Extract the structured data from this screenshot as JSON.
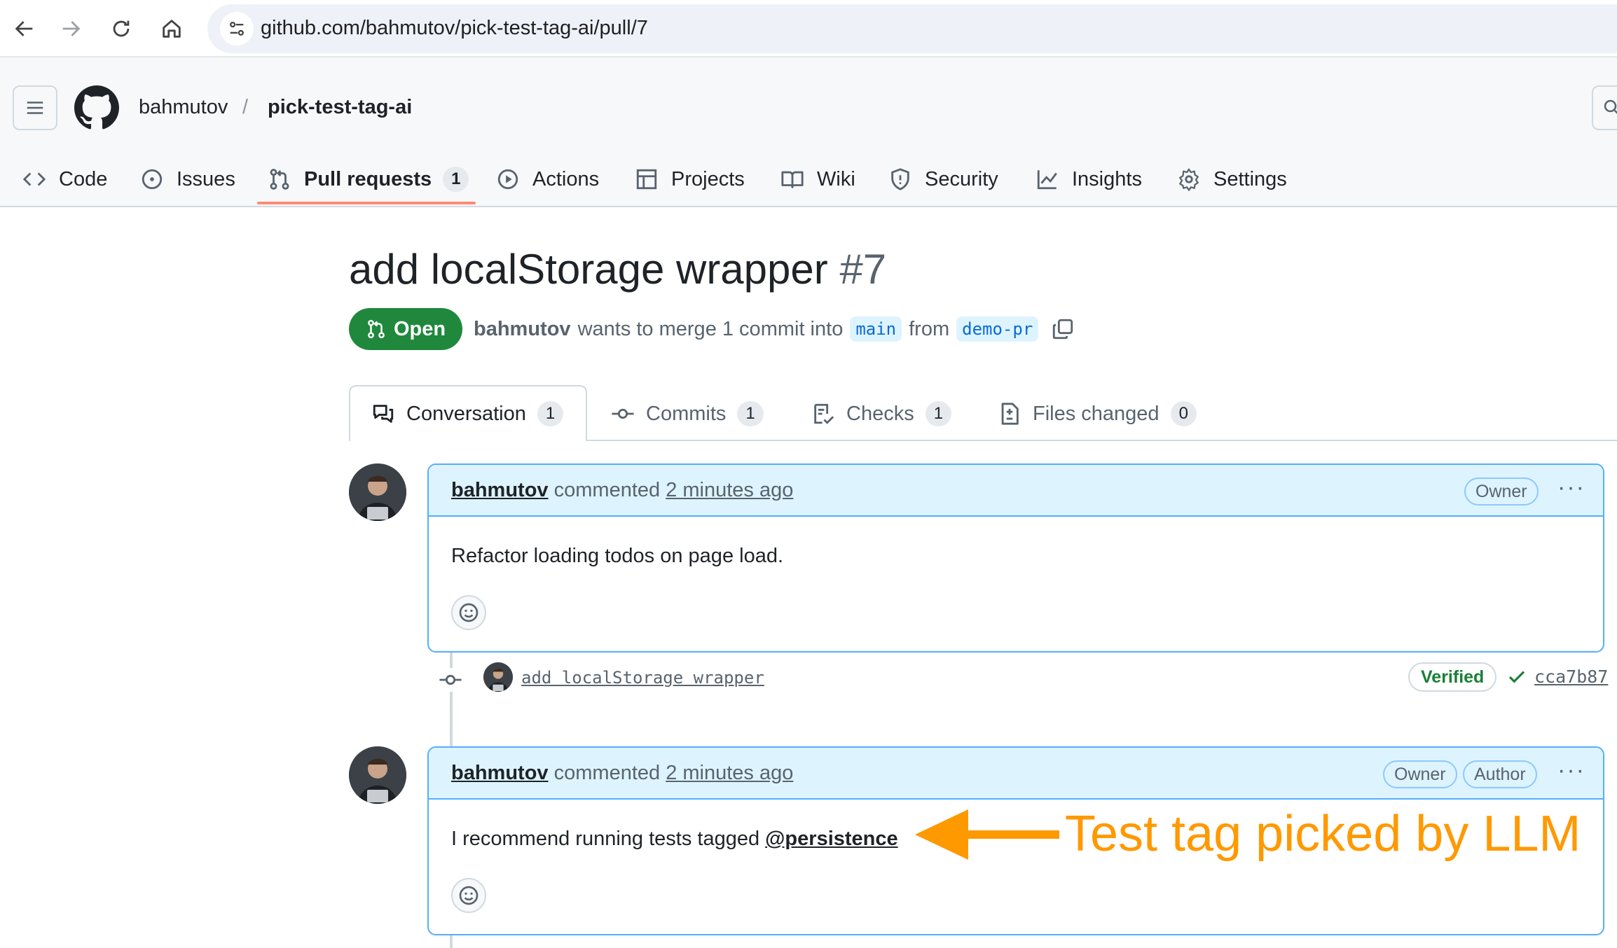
{
  "browser": {
    "url": "github.com/bahmutov/pick-test-tag-ai/pull/7"
  },
  "repo": {
    "owner": "bahmutov",
    "separator": "/",
    "name": "pick-test-tag-ai"
  },
  "repo_nav": {
    "tabs": [
      {
        "label": "Code",
        "icon": "code-icon"
      },
      {
        "label": "Issues",
        "icon": "issue-icon"
      },
      {
        "label": "Pull requests",
        "icon": "pull-request-icon",
        "counter": "1",
        "selected": true
      },
      {
        "label": "Actions",
        "icon": "play-icon"
      },
      {
        "label": "Projects",
        "icon": "table-icon"
      },
      {
        "label": "Wiki",
        "icon": "book-icon"
      },
      {
        "label": "Security",
        "icon": "shield-icon"
      },
      {
        "label": "Insights",
        "icon": "graph-icon"
      },
      {
        "label": "Settings",
        "icon": "gear-icon"
      }
    ]
  },
  "pr": {
    "title": "add localStorage wrapper",
    "number": "#7",
    "state": "Open",
    "author": "bahmutov",
    "merge_text": "wants to merge 1 commit into",
    "base_branch": "main",
    "from_text": "from",
    "head_branch": "demo-pr"
  },
  "pr_tabs": [
    {
      "label": "Conversation",
      "counter": "1",
      "icon": "comment-discussion-icon",
      "active": true
    },
    {
      "label": "Commits",
      "counter": "1",
      "icon": "commit-icon"
    },
    {
      "label": "Checks",
      "counter": "1",
      "icon": "checklist-icon"
    },
    {
      "label": "Files changed",
      "counter": "0",
      "icon": "file-diff-icon"
    }
  ],
  "timeline": {
    "comment1": {
      "author": "bahmutov",
      "action": "commented",
      "time": "2 minutes ago",
      "roles": [
        "Owner"
      ],
      "body": "Refactor loading todos on page load."
    },
    "commit": {
      "message": "add localStorage wrapper",
      "verified": "Verified",
      "sha": "cca7b87"
    },
    "comment2": {
      "author": "bahmutov",
      "action": "commented",
      "time": "2 minutes ago",
      "roles": [
        "Owner",
        "Author"
      ],
      "body_prefix": "I recommend running tests tagged",
      "tag": "@persistence"
    }
  },
  "annotation": {
    "text": "Test tag picked by LLM",
    "color": "#ff9900"
  },
  "colors": {
    "accent_green": "#1f883d",
    "link_blue": "#0969da",
    "comment_header_bg": "#ddf4ff",
    "tab_underline": "#fd8c73"
  }
}
